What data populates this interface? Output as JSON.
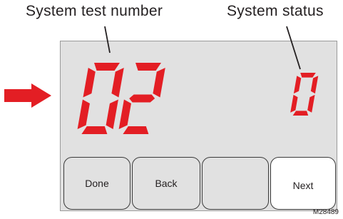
{
  "labels": {
    "system_test_number": "System test number",
    "system_status": "System status"
  },
  "display": {
    "test_number": "02",
    "status_value": "0",
    "digit_color": "#e31e24"
  },
  "buttons": [
    {
      "label": "Done"
    },
    {
      "label": "Back"
    },
    {
      "label": ""
    },
    {
      "label": "Next"
    }
  ],
  "figure_code": "M28489",
  "icons": [
    "arrow-right-icon"
  ]
}
